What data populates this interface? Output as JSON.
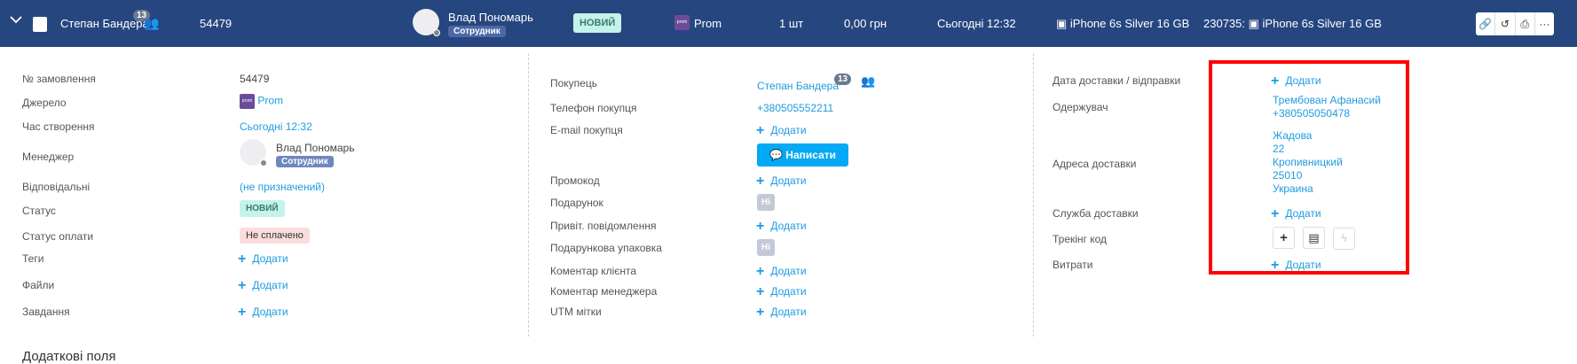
{
  "header": {
    "customer": "Степан Бандера",
    "customer_count": "13",
    "order_id": "54479",
    "manager": "Влад Пономарь",
    "manager_role": "Сотрудник",
    "status": "НОВИЙ",
    "source": "Prom",
    "source_icon_text": "prom",
    "quantity": "1 шт",
    "amount": "0,00 грн",
    "created": "Сьогодні 12:32",
    "product": "iPhone 6s Silver 16 GB",
    "product_sku_prefix": "230735:",
    "product_sku": "iPhone 6s Silver 16 GB",
    "toolbar": [
      "link-icon",
      "history-icon",
      "print-icon",
      "more-icon"
    ],
    "more_label": "···"
  },
  "left": {
    "order_no_label": "№ замовлення",
    "order_no": "54479",
    "source_label": "Джерело",
    "source": "Prom",
    "created_label": "Час створення",
    "created": "Сьогодні 12:32",
    "manager_label": "Менеджер",
    "manager": "Влад Пономарь",
    "manager_role": "Сотрудник",
    "responsible_label": "Відповідальні",
    "responsible": "(не призначений)",
    "status_label": "Статус",
    "status": "НОВИЙ",
    "payment_label": "Статус оплати",
    "payment": "Не сплачено",
    "tags_label": "Теги",
    "files_label": "Файли",
    "tasks_label": "Завдання",
    "add": "Додати"
  },
  "middle": {
    "buyer_label": "Покупець",
    "buyer": "Степан Бандера",
    "buyer_count": "13",
    "phone_label": "Телефон покупця",
    "phone": "+380505552211",
    "email_label": "E-mail покупця",
    "write_button": "Написати",
    "promo_label": "Промокод",
    "gift_label": "Подарунок",
    "gift": "Ні",
    "greeting_label": "Привіт. повідомлення",
    "gift_wrap_label": "Подарункова упаковка",
    "gift_wrap": "Ні",
    "client_comment_label": "Коментар клієнта",
    "manager_comment_label": "Коментар менеджера",
    "utm_label": "UTM мітки",
    "add": "Додати"
  },
  "right": {
    "delivery_date_label": "Дата доставки / відправки",
    "recipient_label": "Одержувач",
    "recipient_name": "Трембован Афанасий",
    "recipient_phone": "+380505050478",
    "address_label": "Адреса доставки",
    "address": [
      "Жадова",
      "22",
      "Кропивницкий",
      "25010",
      "Украина"
    ],
    "service_label": "Служба доставки",
    "tracking_label": "Трекінг код",
    "costs_label": "Витрати",
    "add": "Додати"
  },
  "footer": {
    "extra_fields": "Додаткові поля"
  }
}
